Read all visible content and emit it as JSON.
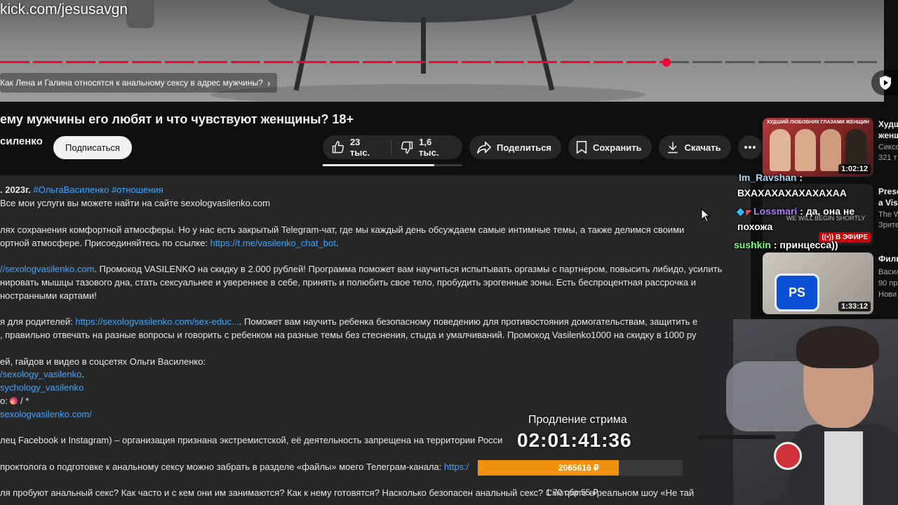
{
  "overlay": {
    "url": "kick.com/jesusavgn"
  },
  "player": {
    "chapter_title": "Как Лена и Галина относятся к анальному сексу в адрес мужчины?",
    "progress": 0.76,
    "colors": {
      "played": "#ff0033",
      "unplayed": "#555555"
    }
  },
  "video": {
    "title": "ему мужчины его любят и что чувствуют женщины? 18+",
    "channel": "силенко",
    "subscribe_label": "Подписаться",
    "like_count": "23 тыс.",
    "dislike_count": "1,6 тыс.",
    "share_label": "Поделиться",
    "save_label": "Сохранить",
    "download_label": "Скачать",
    "like_ratio": 0.8
  },
  "description": {
    "date": ". 2023г.",
    "hashtags": "#ОльгаВасиленко #отношения",
    "l1": "Все мои услуги вы можете найти на сайте sexologvasilenko.com",
    "l2": "лях сохранения комфортной атмосферы. Но у нас есть закрытый Telegram-чат, где мы каждый день обсуждаем самые интимные темы, а также делимся своими",
    "l3a": "ортной атмосфере. Присоединяйтесь по ссылке: ",
    "l3_link": "https://t.me/vasilenko_chat_bot",
    "l3b": ".",
    "l4_link": "//sexologvasilenko.com",
    "l4b": ". Промокод VASILENKO на скидку в 2.000 рублей! Программа поможет вам научиться испытывать оргазмы с партнером, повысить либидо, усилить",
    "l5": "нировать мышцы тазового дна, стать сексуальнее и увереннее в себе, принять и полюбить свое тело, пробудить эрогенные зоны. Есть беспроцентная рассрочка и",
    "l6": "ностранными картами!",
    "l7a": "я для родителей: ",
    "l7_link": "https://sexologvasilenko.com/sex-educ...",
    "l7b": ". Поможет вам научить ребенка безопасному поведению для противостояния домогательствам, защитить его от",
    "l8": ", правильно отвечать на разные вопросы и говорить с ребенком на разные темы без стеснения, стыда и умалчиваний. Промокод Vasilenko1000 на скидку в 1000 ру",
    "l9": "ей, гайдов и видео в соцсетях Ольги Василенко:",
    "l10_link": "/sexology_vasilenko",
    "l10b": ".",
    "l11_link": "sychology_vasilenko",
    "l12a": "o: ",
    "l12b": " / *",
    "l13_link": "sexologvasilenko.com/",
    "l14": "лец Facebook и Instagram) – организация признана экстремистской, её деятельность запрещена на территории Росси",
    "l15a": "проктолога о подготовке к анальному сексу можно забрать в разделе «файлы» моего Телеграм-канала: ",
    "l15_link": "https:/",
    "l16": "ля пробуют анальный секс? Как часто и с кем они им занимаются? Как к нему готовятся? Насколько безопасен анальный секс? Смотрите в реальном шоу «Не тай"
  },
  "recommendations": [
    {
      "thumb_caption": "ХУДШИЙ ЛЮБОВНИК ГЛАЗАМИ ЖЕНЩИН",
      "duration": "1:02:12",
      "title1": "Худш",
      "title2": "женщ",
      "meta1": "Сексо",
      "meta2": "321 т"
    },
    {
      "thumb_caption": "WE WILL BEGIN SHORTLY",
      "live_badge": "В ЭФИРЕ",
      "title1": "Prese",
      "title2": "a Vis",
      "meta1": "The W",
      "meta2": "Зрите"
    },
    {
      "thumb_caption": "PS",
      "duration": "1:33:12",
      "title1": "Филь",
      "meta1": "Васил",
      "meta2": "90 пр",
      "meta3": "Нови"
    }
  ],
  "chat": [
    {
      "user": "Im_Ravshan",
      "sep": " :",
      "text": "ВХАХАХАХАХАХАХАА",
      "color": "#a6d8ff"
    },
    {
      "user": "Lossmari",
      "sep": " :",
      "text": " да, она не",
      "text2": "похожа",
      "color": "#b07bff"
    },
    {
      "user": "sushkin",
      "sep": " :",
      "text": " принцесса))",
      "color": "#7cff7c"
    }
  ],
  "extension": {
    "label": "Продление стрима",
    "timer": "02:01:41:36",
    "amount": "2065616 ₽",
    "goal": "1 70 обр 55 ₽",
    "fill_ratio": 0.69,
    "fill_color": "#f0920e"
  }
}
